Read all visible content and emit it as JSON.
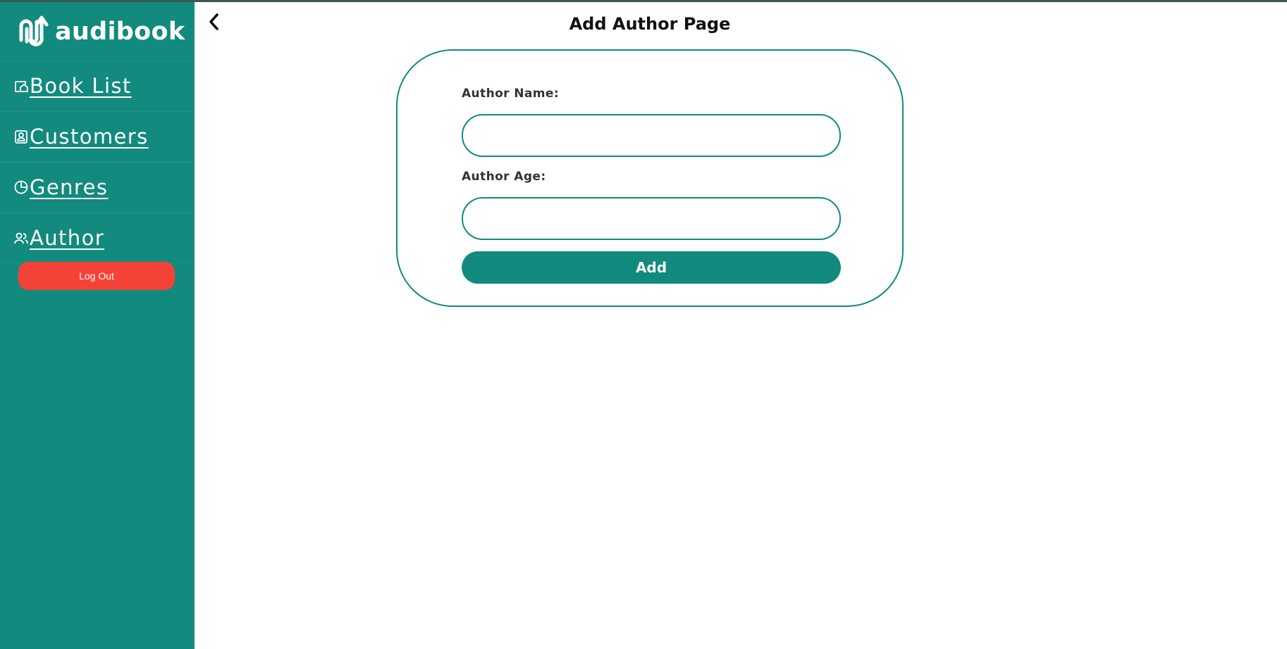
{
  "app": {
    "brand_name": "audibook",
    "logo_icon": "audibook-logo-icon"
  },
  "colors": {
    "primary": "#128a7e",
    "danger": "#f44336",
    "title": "#111111"
  },
  "sidebar": {
    "items": [
      {
        "label": "Book List",
        "icon": "book-list-icon"
      },
      {
        "label": "Customers",
        "icon": "customers-icon"
      },
      {
        "label": "Genres",
        "icon": "genres-icon"
      },
      {
        "label": "Author",
        "icon": "author-icon"
      }
    ],
    "logout_label": "Log Out"
  },
  "header": {
    "back_icon": "chevron-left-icon",
    "title": "Add Author Page"
  },
  "form": {
    "author_name_label": "Author Name:",
    "author_name_value": "",
    "author_age_label": "Author Age:",
    "author_age_value": "",
    "submit_label": "Add"
  }
}
